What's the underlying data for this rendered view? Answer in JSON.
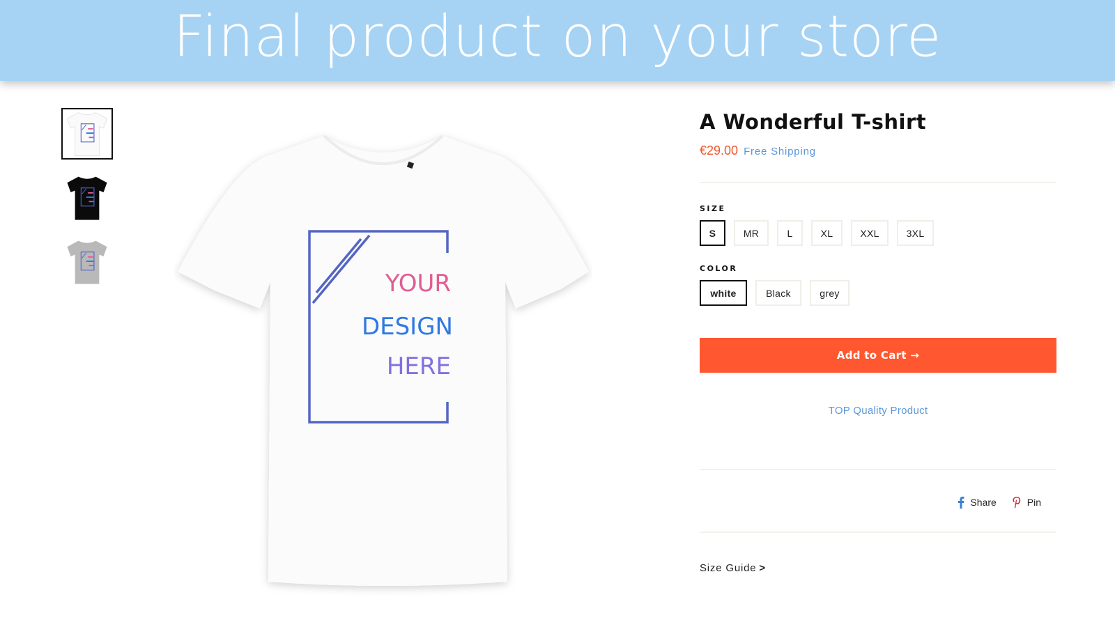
{
  "banner": {
    "title": "Final product on your store",
    "background": "#a6d3f4"
  },
  "gallery": {
    "thumbnails": [
      {
        "label": "white t-shirt",
        "color": "#ffffff",
        "active": true
      },
      {
        "label": "black t-shirt",
        "color": "#0b0b0b",
        "active": false
      },
      {
        "label": "grey t-shirt",
        "color": "#b9b9b9",
        "active": false
      }
    ],
    "design_text": {
      "line1": "YOUR",
      "line2": "DESIGN",
      "line3": "HERE",
      "line1_color": "#e05d93",
      "line2_color": "#2f79e0",
      "line3_color": "#8370e0",
      "frame_color": "#5465c4"
    }
  },
  "product": {
    "title": "A Wonderful T-shirt",
    "price": "€29.00",
    "shipping": "Free Shipping",
    "size_label": "SIZE",
    "sizes": [
      "S",
      "MR",
      "L",
      "XL",
      "XXL",
      "3XL"
    ],
    "selected_size": "S",
    "color_label": "COLOR",
    "colors": [
      "white",
      "Black",
      "grey"
    ],
    "selected_color": "white",
    "add_to_cart": "Add to Cart →",
    "quality_note": "TOP Quality Product",
    "share_label": "Share",
    "pin_label": "Pin",
    "size_guide_label": "Size Guide",
    "size_guide_chevron": ">",
    "accent_color": "#ff572f",
    "price_color": "#f0572e",
    "link_color": "#5b97d8"
  }
}
